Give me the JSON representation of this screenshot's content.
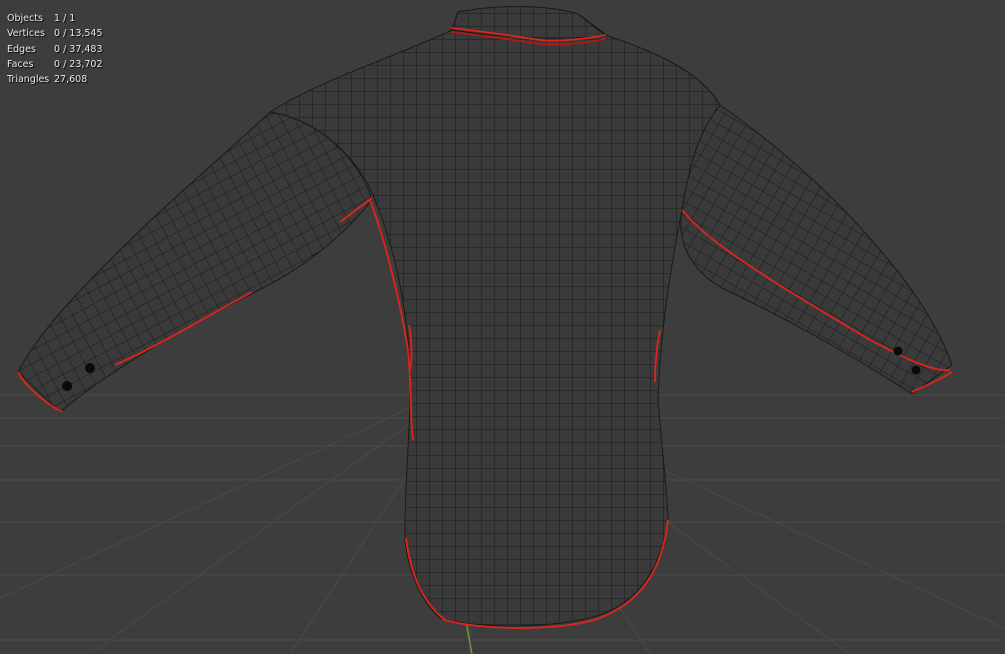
{
  "stats": {
    "objects": {
      "label": "Objects",
      "value": "1 / 1"
    },
    "vertices": {
      "label": "Vertices",
      "value": "0 / 13,545"
    },
    "edges": {
      "label": "Edges",
      "value": "0 / 37,483"
    },
    "faces": {
      "label": "Faces",
      "value": "0 / 23,702"
    },
    "triangles": {
      "label": "Triangles",
      "value": "27,608"
    }
  },
  "colors": {
    "background": "#3d3d3d",
    "grid": "#4a4a4a",
    "mesh_fill": "#3a3a3a",
    "wireframe": "#1a1a1a",
    "seam": "#e0241b",
    "axis_y": "#6e9a2e"
  },
  "icons": {
    "button": "circle"
  }
}
